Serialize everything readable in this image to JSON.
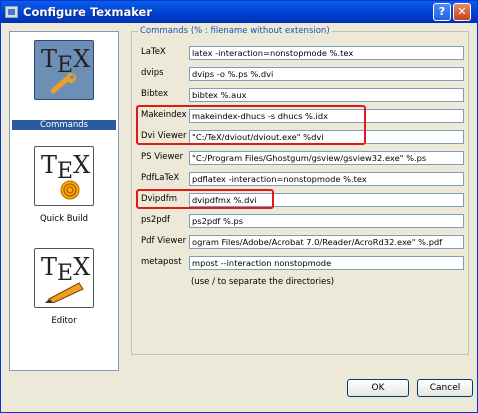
{
  "window": {
    "title": "Configure Texmaker"
  },
  "sidebar": {
    "items": [
      {
        "label": "Commands",
        "logo": "TEX",
        "icon": "wrench-icon"
      },
      {
        "label": "Quick Build",
        "logo": "TEX",
        "icon": "spiral-icon"
      },
      {
        "label": "Editor",
        "logo": "TEX",
        "icon": "pencil-icon"
      }
    ]
  },
  "commands": {
    "group_title": "Commands (% : filename without extension)",
    "rows": [
      {
        "label": "LaTeX",
        "value": "latex -interaction=nonstopmode %.tex"
      },
      {
        "label": "dvips",
        "value": "dvips -o %.ps %.dvi"
      },
      {
        "label": "Bibtex",
        "value": "bibtex %.aux"
      },
      {
        "label": "Makeindex",
        "value": "makeindex-dhucs -s dhucs %.idx"
      },
      {
        "label": "Dvi Viewer",
        "value": "\"C:/TeX/dviout/dviout.exe\" %dvi"
      },
      {
        "label": "PS Viewer",
        "value": "\"C:/Program Files/Ghostgum/gsview/gsview32.exe\" %.ps"
      },
      {
        "label": "PdfLaTeX",
        "value": "pdflatex -interaction=nonstopmode %.tex"
      },
      {
        "label": "Dvipdfm",
        "value": "dvipdfmx %.dvi"
      },
      {
        "label": "ps2pdf",
        "value": "ps2pdf %.ps"
      },
      {
        "label": "Pdf Viewer",
        "value": "ogram Files/Adobe/Acrobat 7.0/Reader/AcroRd32.exe\" %.pdf"
      },
      {
        "label": "metapost",
        "value": "mpost --interaction nonstopmode"
      }
    ],
    "hint": "(use / to separate the directories)"
  },
  "buttons": {
    "ok": "OK",
    "cancel": "Cancel"
  },
  "colors": {
    "titlebar": "#0040d0",
    "highlight": "#e01818",
    "selected": "#2c5aa0"
  }
}
